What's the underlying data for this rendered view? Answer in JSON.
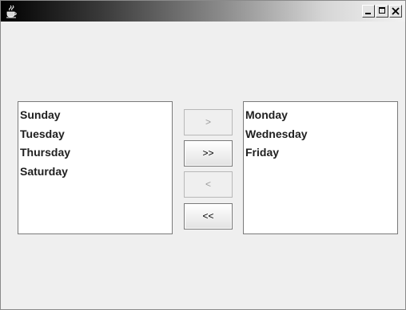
{
  "window": {
    "title": "",
    "controls": {
      "minimize_icon": "minimize-icon",
      "maximize_icon": "maximize-icon",
      "close_icon": "close-icon"
    }
  },
  "left_list": {
    "items": [
      "Sunday",
      "Tuesday",
      "Thursday",
      "Saturday"
    ]
  },
  "right_list": {
    "items": [
      "Monday",
      "Wednesday",
      "Friday"
    ]
  },
  "buttons": {
    "add_label": ">",
    "add_enabled": false,
    "add_all_label": ">>",
    "add_all_enabled": true,
    "remove_label": "<",
    "remove_enabled": false,
    "remove_all_label": "<<",
    "remove_all_enabled": true
  },
  "colors": {
    "window_background": "#efefef",
    "list_background": "#ffffff",
    "disabled_text": "#9a9a9a"
  }
}
